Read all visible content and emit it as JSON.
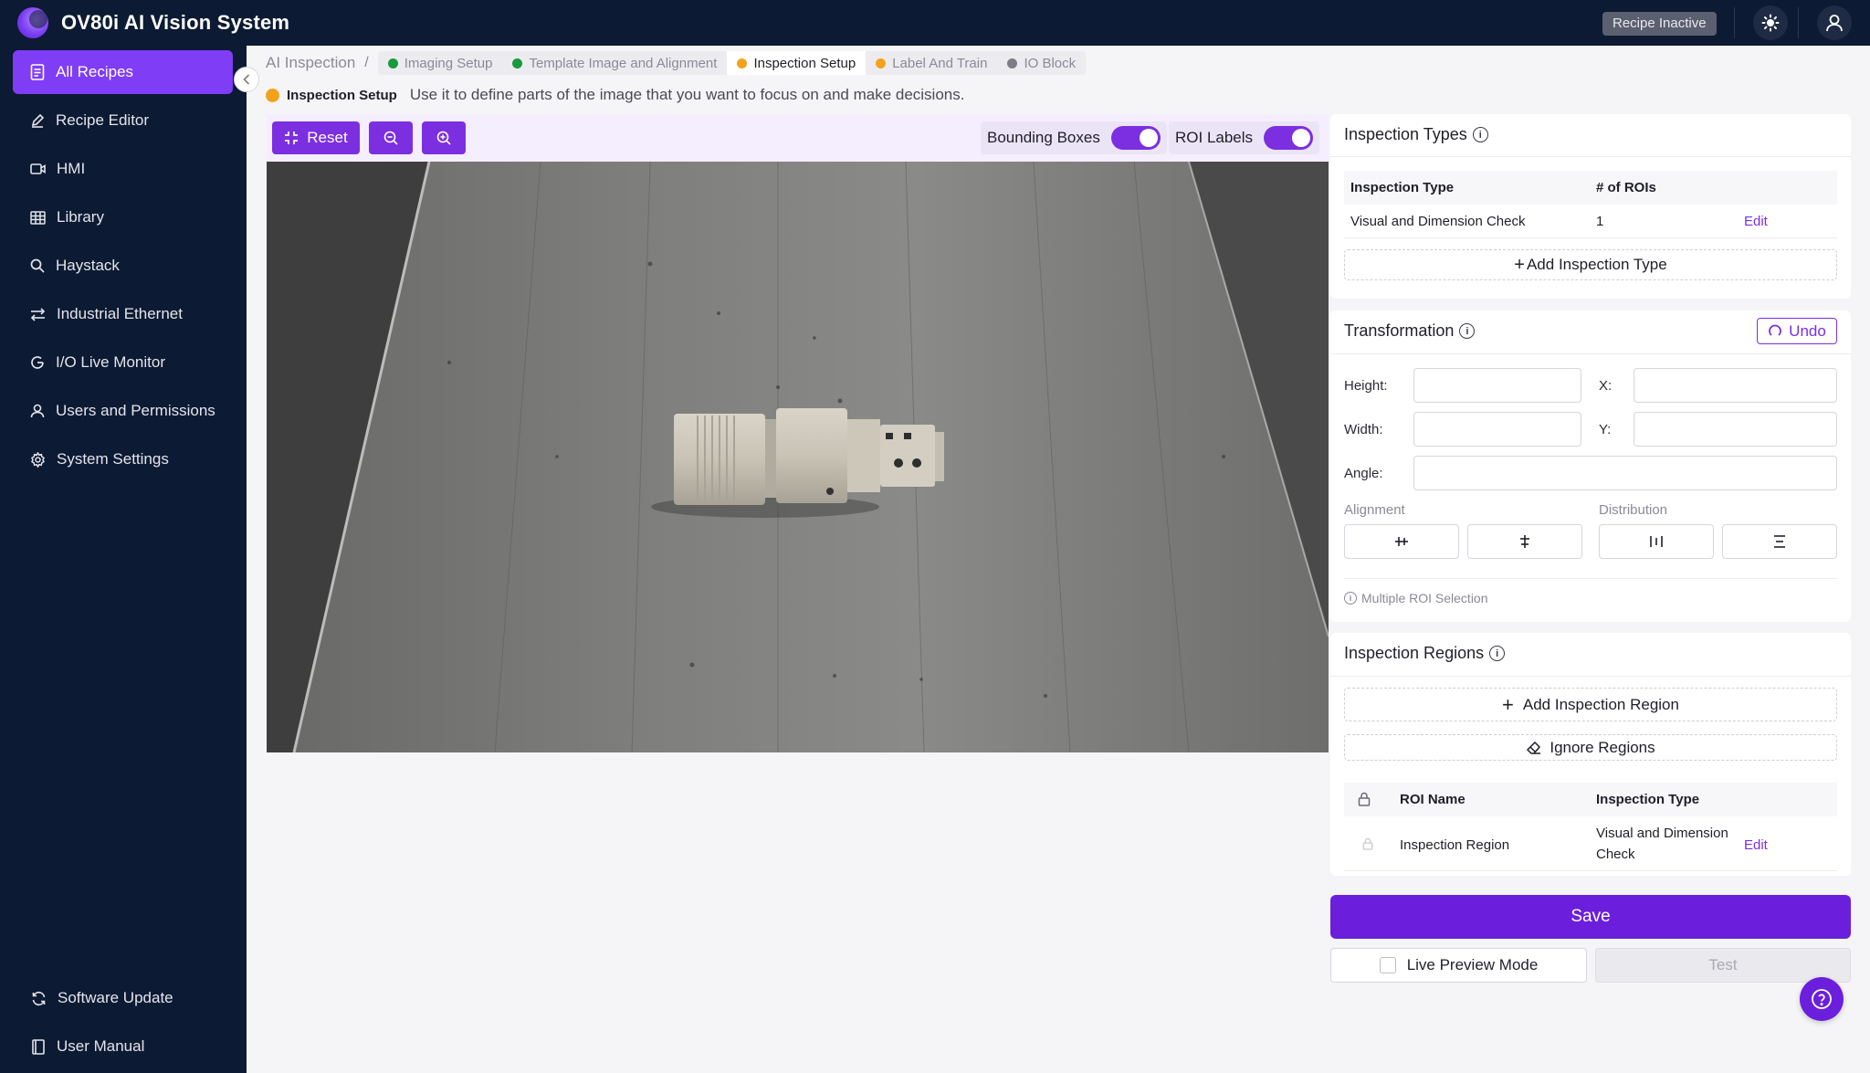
{
  "app": {
    "title": "OV80i AI Vision System",
    "status_badge": "Recipe Inactive"
  },
  "sidebar": {
    "items": [
      {
        "label": "All Recipes",
        "icon": "document-icon",
        "active": true
      },
      {
        "label": "Recipe Editor",
        "icon": "pencil-icon"
      },
      {
        "label": "HMI",
        "icon": "video-icon"
      },
      {
        "label": "Library",
        "icon": "table-icon"
      },
      {
        "label": "Haystack",
        "icon": "search-icon"
      },
      {
        "label": "Industrial Ethernet",
        "icon": "ethernet-icon"
      },
      {
        "label": "I/O Live Monitor",
        "icon": "monitor-icon"
      },
      {
        "label": "Users and Permissions",
        "icon": "user-icon"
      },
      {
        "label": "System Settings",
        "icon": "gear-icon"
      }
    ],
    "bottom": [
      {
        "label": "Software Update",
        "icon": "refresh-icon"
      },
      {
        "label": "User Manual",
        "icon": "book-icon"
      }
    ]
  },
  "breadcrumb": {
    "root": "AI Inspection",
    "separator": "/",
    "steps": [
      {
        "label": "Imaging Setup",
        "color": "#1a9a3a"
      },
      {
        "label": "Template Image and Alignment",
        "color": "#1a9a3a"
      },
      {
        "label": "Inspection Setup",
        "color": "#f4a21c",
        "active": true
      },
      {
        "label": "Label And Train",
        "color": "#f4a21c"
      },
      {
        "label": "IO Block",
        "color": "#7d7d86"
      }
    ]
  },
  "section": {
    "title": "Inspection Setup",
    "description": "Use it to define parts of the image that you want to focus on and make decisions."
  },
  "toolbar": {
    "reset_label": "Reset",
    "bounding_boxes_label": "Bounding Boxes",
    "bounding_boxes_on": true,
    "roi_labels_label": "ROI Labels",
    "roi_labels_on": true
  },
  "inspection_types": {
    "title": "Inspection Types",
    "columns": [
      "Inspection Type",
      "# of ROIs"
    ],
    "rows": [
      {
        "type": "Visual and Dimension Check",
        "rois": "1",
        "action": "Edit"
      }
    ],
    "add_label": "Add Inspection Type"
  },
  "transformation": {
    "title": "Transformation",
    "undo_label": "Undo",
    "height_label": "Height:",
    "width_label": "Width:",
    "angle_label": "Angle:",
    "x_label": "X:",
    "y_label": "Y:",
    "alignment_label": "Alignment",
    "distribution_label": "Distribution",
    "multi_roi_note": "Multiple ROI Selection"
  },
  "inspection_regions": {
    "title": "Inspection Regions",
    "add_label": "Add Inspection Region",
    "ignore_label": "Ignore Regions",
    "columns": [
      "ROI Name",
      "Inspection Type"
    ],
    "rows": [
      {
        "name": "Inspection Region",
        "type_line1": "Visual and Dimension",
        "type_line2": "Check",
        "action": "Edit"
      }
    ]
  },
  "actions": {
    "save_label": "Save",
    "live_preview_label": "Live Preview Mode",
    "test_label": "Test"
  },
  "colors": {
    "accent": "#7b2fe0",
    "sidebar_bg": "#0d1a33",
    "active_nav": "#7f3df5"
  }
}
